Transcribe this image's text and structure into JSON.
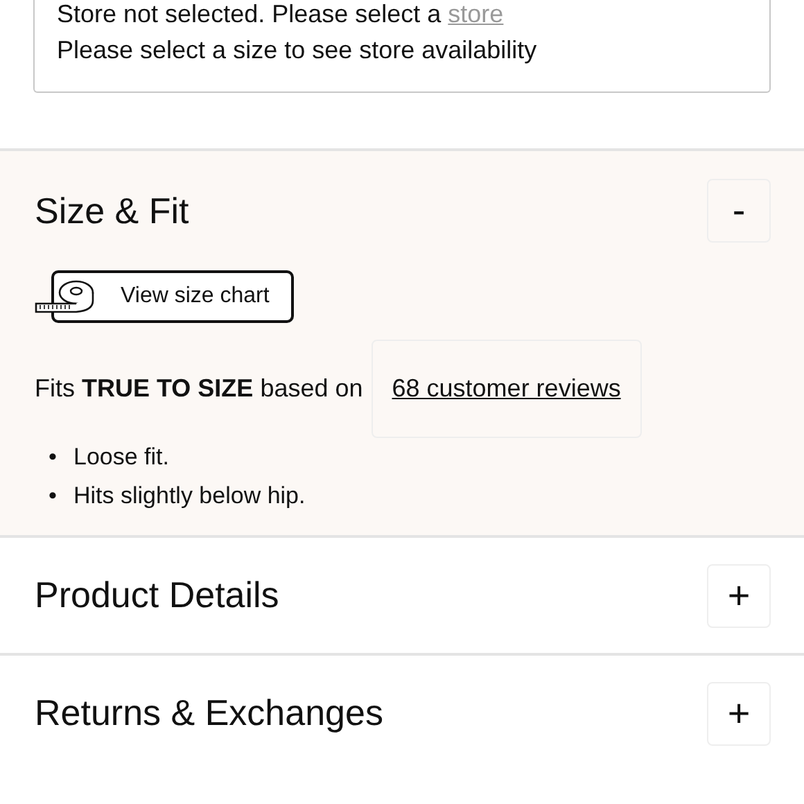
{
  "store_notice": {
    "text": "Store not selected. Please select a ",
    "link": "store",
    "hint": "Please select a size to see store availability"
  },
  "sections": [
    {
      "title": "Size & Fit",
      "expanded": true,
      "toggle": "-",
      "size_chart_button": "View size chart",
      "fit_text": "Fits **TRUE TO SIZE** based on",
      "reviews_link": "68 customer reviews",
      "bullets": [
        {
          "marker": "•",
          "text": "Loose fit."
        },
        {
          "marker": "•",
          "text": "Hits slightly below hip."
        }
      ]
    },
    {
      "title": "Product Details",
      "expanded": false,
      "toggle": "+"
    },
    {
      "title": "Returns & Exchanges",
      "expanded": false,
      "toggle": "+"
    }
  ]
}
